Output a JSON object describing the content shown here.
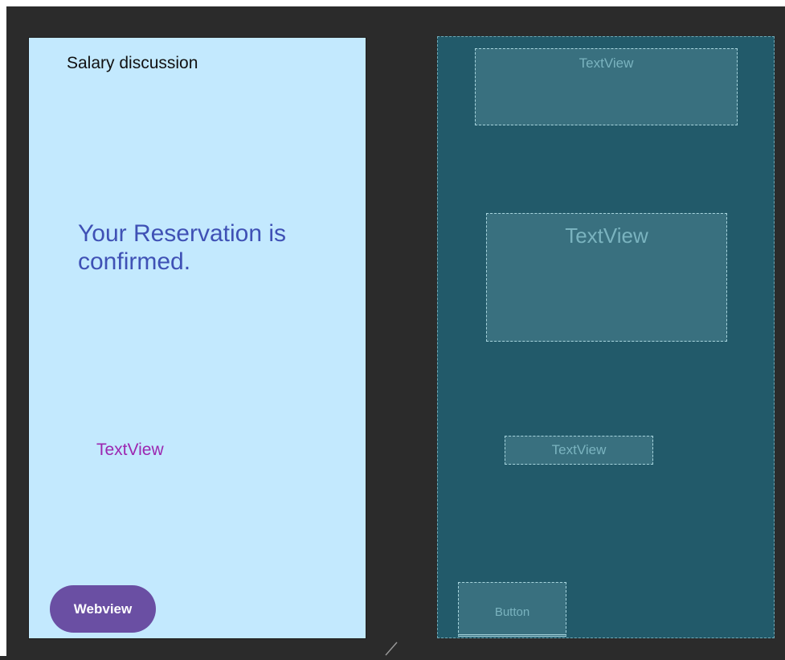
{
  "design": {
    "title": "Salary discussion",
    "headline": "Your Reservation is confirmed.",
    "subtext": "TextView",
    "button_label": "Webview"
  },
  "blueprint": {
    "textview_1": "TextView",
    "textview_2": "TextView",
    "textview_3": "TextView",
    "button": "Button"
  },
  "colors": {
    "design_background": "#c3e9fe",
    "headline": "#3f51b5",
    "subtext": "#9c27b0",
    "button_fill": "#6a4fa3",
    "blueprint_background": "#225a6a",
    "editor_background": "#2b2b2b"
  },
  "icons": {
    "resize_handle": "resize-handle-icon"
  }
}
